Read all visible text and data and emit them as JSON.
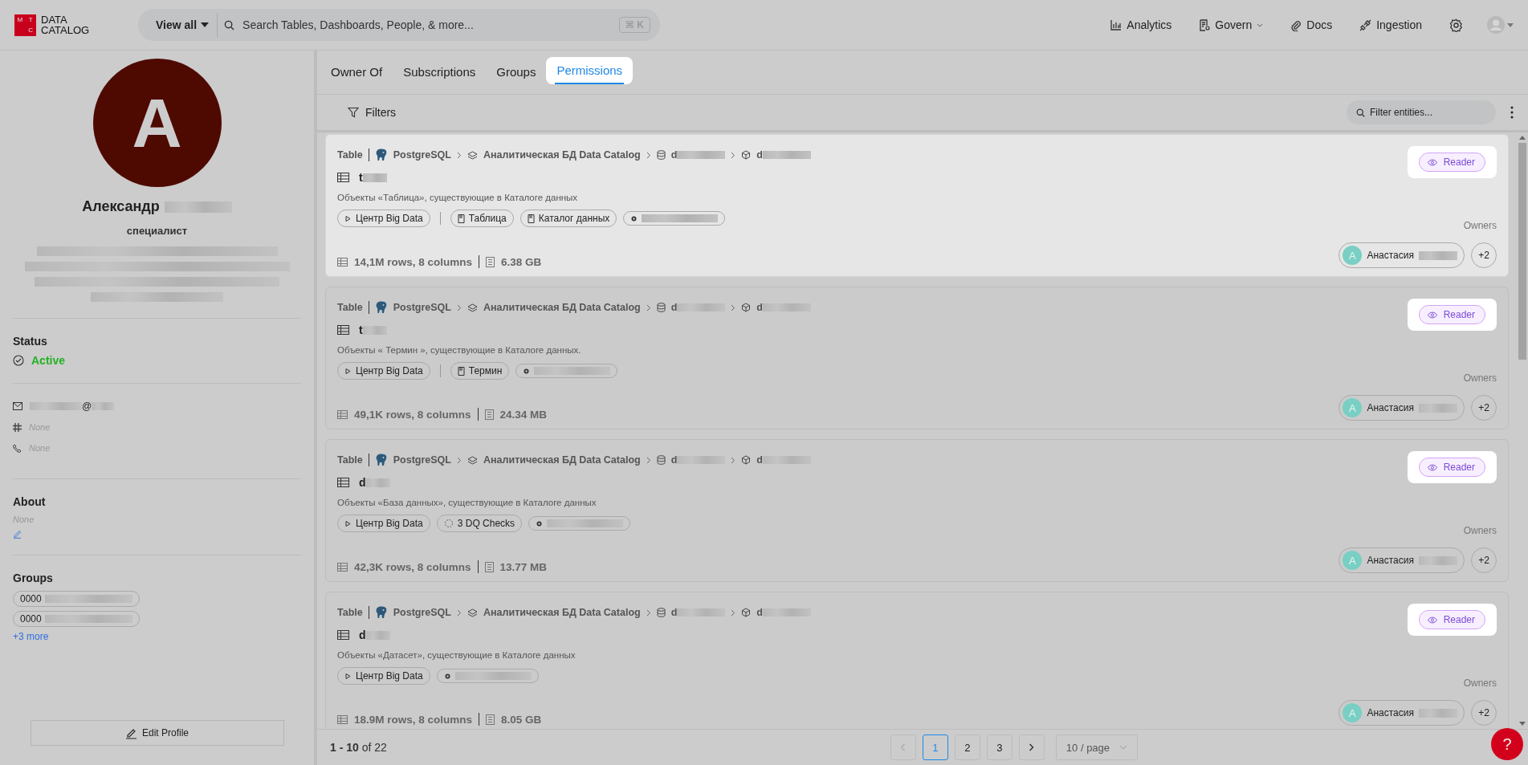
{
  "header": {
    "logo": {
      "letters": [
        "M",
        "T",
        "C"
      ],
      "lines": [
        "DATA",
        "CATALOG"
      ]
    },
    "search": {
      "scope": "View all",
      "placeholder": "Search Tables, Dashboards, People, & more...",
      "shortcut": "⌘ K"
    },
    "nav": [
      {
        "label": "Analytics",
        "kind": "analytics",
        "dropdown": false
      },
      {
        "label": "Govern",
        "kind": "govern",
        "dropdown": true
      },
      {
        "label": "Docs",
        "kind": "docs",
        "dropdown": false
      },
      {
        "label": "Ingestion",
        "kind": "ingestion",
        "dropdown": false
      }
    ]
  },
  "profile": {
    "initial": "A",
    "first_name": "Александр",
    "title": "специалист",
    "status": {
      "heading": "Status",
      "value": "Active"
    },
    "contacts": [
      {
        "kind": "email",
        "value": "@",
        "empty": false
      },
      {
        "kind": "slack",
        "value": "None",
        "empty": true
      },
      {
        "kind": "phone",
        "value": "None",
        "empty": true
      }
    ],
    "about": {
      "heading": "About",
      "value": "None"
    },
    "groups": {
      "heading": "Groups",
      "items": [
        "0000",
        "0000"
      ],
      "more": "+3 more"
    },
    "edit_button": "Edit Profile"
  },
  "tabs": [
    {
      "label": "Owner Of",
      "selected": false
    },
    {
      "label": "Subscriptions",
      "selected": false
    },
    {
      "label": "Groups",
      "selected": false
    },
    {
      "label": "Permissions",
      "selected": true
    }
  ],
  "toolbar": {
    "filters": "Filters",
    "search_placeholder": "Filter entities..."
  },
  "cards": [
    {
      "hovered": true,
      "type": "Table",
      "service": "PostgreSQL",
      "path": [
        {
          "kind": "schema",
          "text": "Аналитическая БД Data Catalog"
        },
        {
          "kind": "database",
          "text": "d"
        },
        {
          "kind": "cube",
          "text": "d"
        }
      ],
      "name": "t",
      "description": "Объекты «Таблица», существующие в Каталоге данных",
      "tags": [
        {
          "kind": "domain",
          "text": "Центр Big Data"
        },
        {
          "kind": "glossary",
          "text": "Таблица"
        },
        {
          "kind": "glossary",
          "text": "Каталог данных"
        },
        {
          "kind": "tag"
        }
      ],
      "rows": "14,1M rows, 8 columns",
      "size": "6.38 GB",
      "permission": "Reader",
      "owners_label": "Owners",
      "owner": "Анастасия",
      "owner_initial": "A",
      "more_owners": "+2"
    },
    {
      "hovered": false,
      "type": "Table",
      "service": "PostgreSQL",
      "path": [
        {
          "kind": "schema",
          "text": "Аналитическая БД Data Catalog"
        },
        {
          "kind": "database",
          "text": "d"
        },
        {
          "kind": "cube",
          "text": "d"
        }
      ],
      "name": "t",
      "description": "Объекты « Термин », существующие в Каталоге данных.",
      "tags": [
        {
          "kind": "domain",
          "text": "Центр Big Data"
        },
        {
          "kind": "glossary",
          "text": "Термин"
        },
        {
          "kind": "tag"
        }
      ],
      "rows": "49,1K rows, 8 columns",
      "size": "24.34 MB",
      "permission": "Reader",
      "owners_label": "Owners",
      "owner": "Анастасия",
      "owner_initial": "A",
      "more_owners": "+2"
    },
    {
      "hovered": false,
      "type": "Table",
      "service": "PostgreSQL",
      "path": [
        {
          "kind": "schema",
          "text": "Аналитическая БД Data Catalog"
        },
        {
          "kind": "database",
          "text": "d"
        },
        {
          "kind": "cube",
          "text": "d"
        }
      ],
      "name": "d",
      "description": "Объекты «База данных», существующие в Каталоге данных",
      "tags": [
        {
          "kind": "domain",
          "text": "Центр Big Data"
        },
        {
          "kind": "dq",
          "text": "3 DQ Checks"
        },
        {
          "kind": "tag"
        }
      ],
      "rows": "42,3K rows, 8 columns",
      "size": "13.77 MB",
      "permission": "Reader",
      "owners_label": "Owners",
      "owner": "Анастасия",
      "owner_initial": "A",
      "more_owners": "+2"
    },
    {
      "hovered": false,
      "type": "Table",
      "service": "PostgreSQL",
      "path": [
        {
          "kind": "schema",
          "text": "Аналитическая БД Data Catalog"
        },
        {
          "kind": "database",
          "text": "d"
        },
        {
          "kind": "cube",
          "text": "d"
        }
      ],
      "name": "d",
      "description": "Объекты «Датасет», существующие в Каталоге данных",
      "tags": [
        {
          "kind": "domain",
          "text": "Центр Big Data"
        },
        {
          "kind": "tag"
        }
      ],
      "rows": "18.9M rows, 8 columns",
      "size": "8.05 GB",
      "permission": "Reader",
      "owners_label": "Owners",
      "owner": "Анастасия",
      "owner_initial": "A",
      "more_owners": "+2"
    }
  ],
  "pagination": {
    "summary": "**1 - 10** of 22",
    "pages": [
      {
        "label": "1",
        "selected": true
      },
      {
        "label": "2",
        "selected": false
      },
      {
        "label": "3",
        "selected": false
      }
    ],
    "prev_disabled": true,
    "next_disabled": false,
    "page_size": "10 / page"
  },
  "help": "?"
}
